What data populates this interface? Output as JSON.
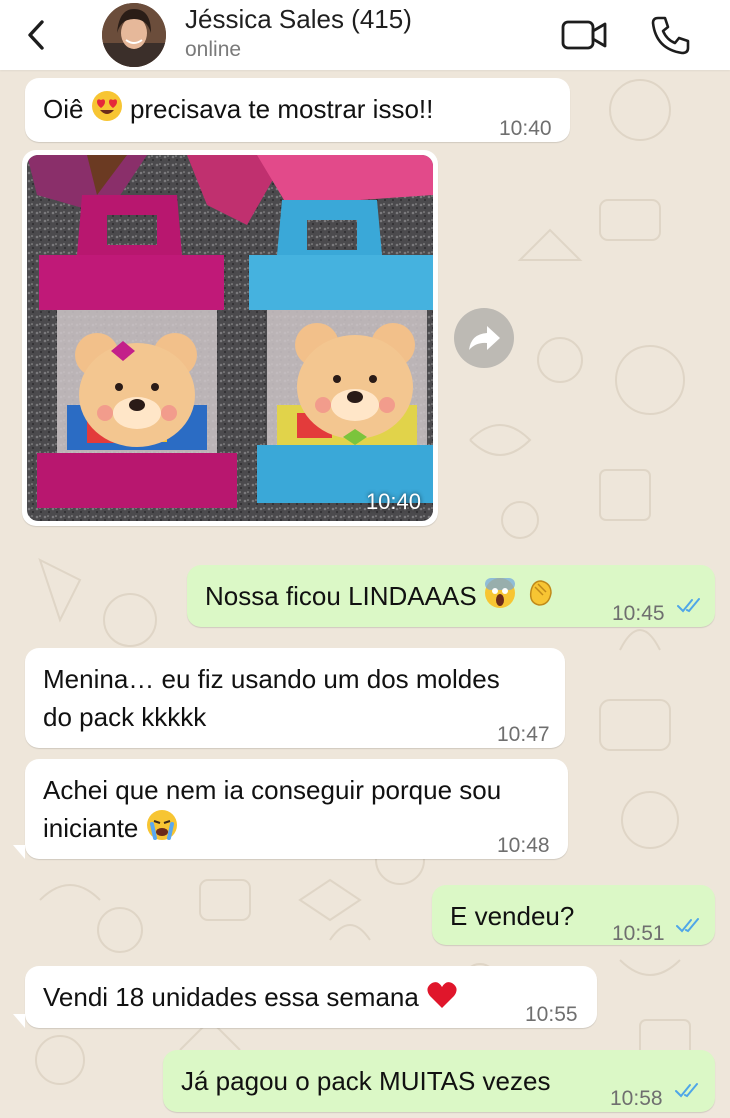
{
  "header": {
    "contact_name": "Jéssica Sales (415)",
    "status": "online"
  },
  "messages": [
    {
      "text": "Oiê",
      "text2": "precisava te mostrar isso!!",
      "time": "10:40"
    },
    {
      "media_time": "10:40"
    },
    {
      "text": "Nossa ficou LINDAAAS",
      "time": "10:45"
    },
    {
      "line1": "Menina… eu fiz usando um dos moldes",
      "line2": "do pack kkkkk",
      "time": "10:47"
    },
    {
      "line1": "Achei que nem ia conseguir porque sou",
      "line2": "iniciante",
      "time": "10:48"
    },
    {
      "text": "E vendeu?",
      "time": "10:51"
    },
    {
      "text": "Vendi 18 unidades essa semana",
      "time": "10:55"
    },
    {
      "text": "Já pagou o pack MUITAS vezes",
      "time": "10:58"
    }
  ],
  "colors": {
    "incoming": "#ffffff",
    "outgoing": "#dbf8c6",
    "read_ticks": "#4fa6e8"
  },
  "icons": [
    "back-icon",
    "video-call-icon",
    "phone-icon",
    "forward-icon",
    "double-check-icon"
  ]
}
